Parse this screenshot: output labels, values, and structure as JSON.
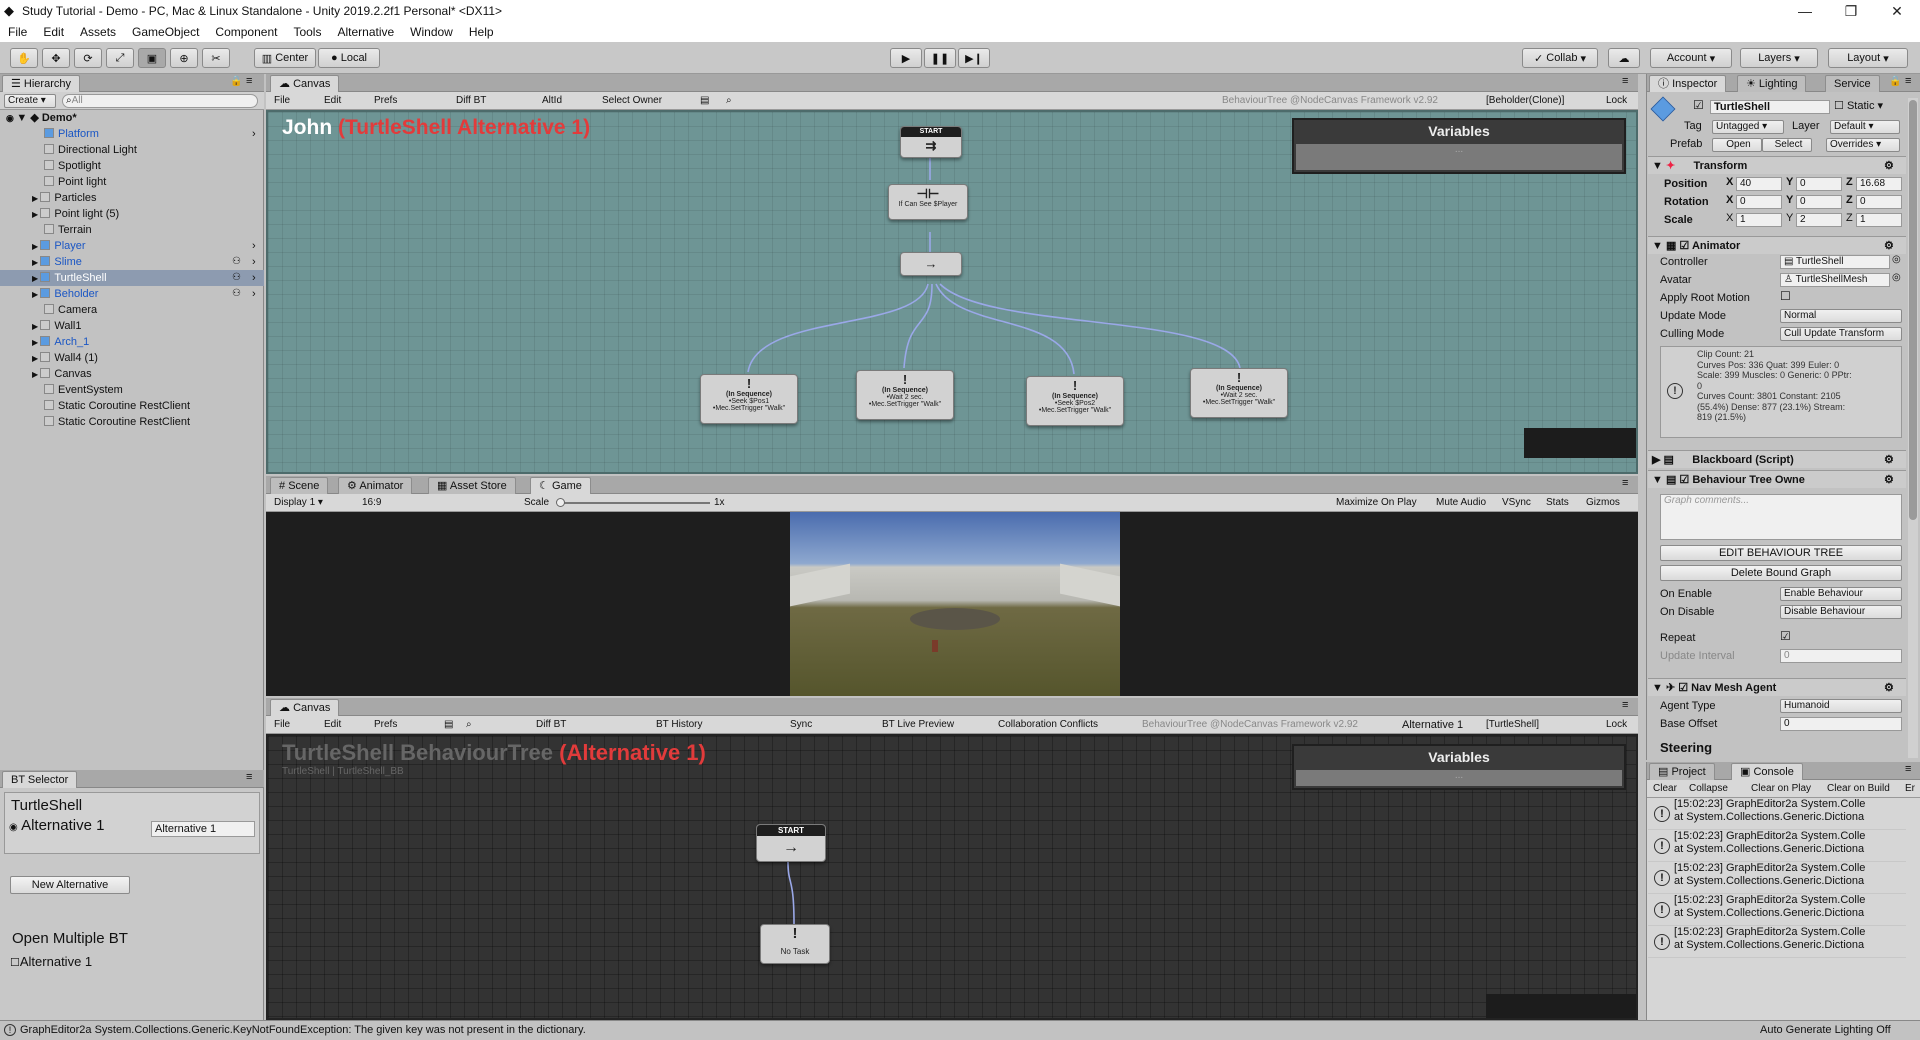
{
  "window": {
    "title": "Study Tutorial - Demo - PC, Mac & Linux Standalone - Unity 2019.2.2f1 Personal* <DX11>"
  },
  "menu": [
    "File",
    "Edit",
    "Assets",
    "GameObject",
    "Component",
    "Tools",
    "Alternative",
    "Window",
    "Help"
  ],
  "toolbar": {
    "center": "Center",
    "local": "Local",
    "collab": "Collab",
    "account": "Account",
    "layers": "Layers",
    "layout": "Layout"
  },
  "hierarchy": {
    "tab": "Hierarchy",
    "create": "Create",
    "search_placeholder": "All",
    "scene": "Demo*",
    "items": [
      "Platform",
      "Directional Light",
      "Spotlight",
      "Point light",
      "Particles",
      "Point light (5)",
      "Terrain",
      "Player",
      "Slime",
      "TurtleShell",
      "Beholder",
      "Camera",
      "Wall1",
      "Arch_1",
      "Wall4 (1)",
      "Canvas",
      "EventSystem",
      "Static Coroutine RestClient",
      "Static Coroutine RestClient"
    ]
  },
  "bt_selector": {
    "tab": "BT Selector",
    "object": "TurtleShell",
    "alt_radio": "Alternative 1",
    "alt_field": "Alternative 1",
    "new_alt": "New Alternative",
    "open_multiple": "Open Multiple BT",
    "open_alt": "Alternative 1"
  },
  "canvas_top": {
    "tab": "Canvas",
    "bar": [
      "File",
      "Edit",
      "Prefs",
      "Diff BT",
      "AltId",
      "Select Owner"
    ],
    "framework": "BehaviourTree @NodeCanvas Framework v2.92",
    "owner": "[Beholder(Clone)]",
    "lock": "Lock",
    "title_name": "John",
    "title_alt": "(TurtleShell Alternative 1)",
    "variables": "Variables",
    "vars_hint": "...",
    "start": "START",
    "cond": "If Can See $Player",
    "seq": [
      {
        "head": "(In Sequence)",
        "l1": "•Seek $Pos1",
        "l2": "•Mec.SetTrigger \"Walk\""
      },
      {
        "head": "(In Sequence)",
        "l1": "•Wait 2 sec.",
        "l2": "•Mec.SetTrigger \"Walk\""
      },
      {
        "head": "(In Sequence)",
        "l1": "•Seek $Pos2",
        "l2": "•Mec.SetTrigger \"Walk\""
      },
      {
        "head": "(In Sequence)",
        "l1": "•Wait 2 sec.",
        "l2": "•Mec.SetTrigger \"Walk\""
      }
    ]
  },
  "game": {
    "tabs": [
      "Scene",
      "Animator",
      "Asset Store",
      "Game"
    ],
    "display": "Display 1",
    "aspect": "16:9",
    "scale_label": "Scale",
    "scale_val": "1x",
    "right": [
      "Maximize On Play",
      "Mute Audio",
      "VSync",
      "Stats",
      "Gizmos"
    ]
  },
  "canvas_bottom": {
    "tab": "Canvas",
    "bar": [
      "File",
      "Edit",
      "Prefs",
      "Diff BT",
      "BT History",
      "Sync",
      "BT Live Preview",
      "Collaboration Conflicts"
    ],
    "framework": "BehaviourTree @NodeCanvas Framework v2.92",
    "alt": "Alternative 1",
    "owner": "[TurtleShell]",
    "lock": "Lock",
    "title_name": "TurtleShell BehaviourTree",
    "title_alt": "(Alternative 1)",
    "subtitle": "TurtleShell | TurtleShell_BB",
    "variables": "Variables",
    "vars_hint": "...",
    "start": "START",
    "notask": "No Task"
  },
  "inspector": {
    "tabs": [
      "Inspector",
      "Lighting",
      "Service"
    ],
    "name": "TurtleShell",
    "static": "Static",
    "tag_label": "Tag",
    "tag": "Untagged",
    "layer_label": "Layer",
    "layer": "Default",
    "prefab": "Prefab",
    "open": "Open",
    "select": "Select",
    "overrides": "Overrides",
    "transform": "Transform",
    "position": [
      "40",
      "0",
      "16.68"
    ],
    "rotation": [
      "0",
      "0",
      "0"
    ],
    "scale": [
      "1",
      "2",
      "1"
    ],
    "pos_label": "Position",
    "rot_label": "Rotation",
    "scale_label": "Scale",
    "animator": "Animator",
    "controller_label": "Controller",
    "controller": "TurtleShell",
    "avatar_label": "Avatar",
    "avatar": "TurtleShellMesh",
    "apply_root": "Apply Root Motion",
    "update_mode_label": "Update Mode",
    "update_mode": "Normal",
    "culling_label": "Culling Mode",
    "culling": "Cull Update Transform",
    "info": [
      "Clip Count: 21",
      "Curves Pos: 336 Quat: 399 Euler: 0",
      "Scale: 399 Muscles: 0 Generic: 0 PPtr:",
      "0",
      "Curves Count: 3801 Constant: 2105",
      "(55.4%) Dense: 877 (23.1%) Stream:",
      "819 (21.5%)"
    ],
    "blackboard": "Blackboard (Script)",
    "bto": "Behaviour Tree Owne",
    "graph_comments": "Graph comments...",
    "edit_bt": "EDIT BEHAVIOUR TREE",
    "delete_bound": "Delete Bound Graph",
    "on_enable_label": "On Enable",
    "on_enable": "Enable Behaviour",
    "on_disable_label": "On Disable",
    "on_disable": "Disable Behaviour",
    "repeat": "Repeat",
    "update_interval": "Update Interval",
    "update_interval_val": "0",
    "nav": "Nav Mesh Agent",
    "agent_type_label": "Agent Type",
    "agent_type": "Humanoid",
    "base_offset_label": "Base Offset",
    "base_offset": "0",
    "steering": "Steering"
  },
  "console": {
    "tabs": [
      "Project",
      "Console"
    ],
    "bar": [
      "Clear",
      "Collapse",
      "Clear on Play",
      "Clear on Build",
      "Er"
    ],
    "entries": [
      {
        "l1": "[15:02:23] GraphEditor2a System.Colle",
        "l2": "at System.Collections.Generic.Dictiona"
      },
      {
        "l1": "[15:02:23] GraphEditor2a System.Colle",
        "l2": "at System.Collections.Generic.Dictiona"
      },
      {
        "l1": "[15:02:23] GraphEditor2a System.Colle",
        "l2": "at System.Collections.Generic.Dictiona"
      },
      {
        "l1": "[15:02:23] GraphEditor2a System.Colle",
        "l2": "at System.Collections.Generic.Dictiona"
      },
      {
        "l1": "[15:02:23] GraphEditor2a System.Colle",
        "l2": "at System.Collections.Generic.Dictiona"
      }
    ]
  },
  "status": {
    "msg": "GraphEditor2a System.Collections.Generic.KeyNotFoundException: The given key was not present in the dictionary.",
    "right": "Auto Generate Lighting Off"
  }
}
